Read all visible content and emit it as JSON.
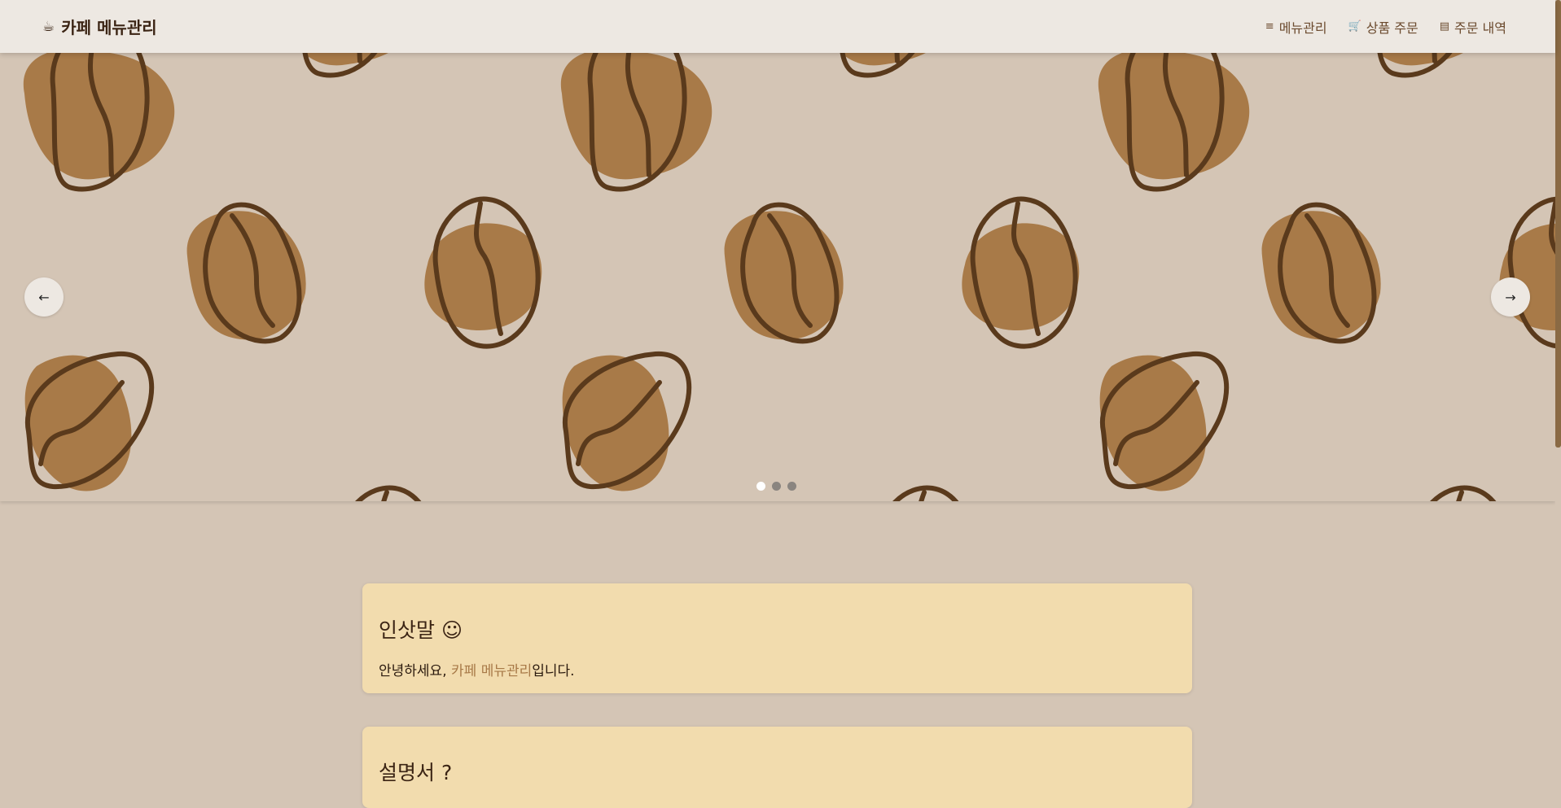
{
  "brand": {
    "icon": "coffee-cup-icon",
    "glyph": "☕",
    "title": "카페 메뉴관리"
  },
  "nav": {
    "items": [
      {
        "icon": "list-icon",
        "glyph": "≡",
        "label": "메뉴관리"
      },
      {
        "icon": "cart-icon",
        "glyph": "🛒",
        "label": "상품 주문"
      },
      {
        "icon": "receipt-icon",
        "glyph": "▤",
        "label": "주문 내역"
      }
    ]
  },
  "carousel": {
    "prev_glyph": "←",
    "next_glyph": "→",
    "slide_count": 3,
    "active_index": 0
  },
  "greeting": {
    "title": "인삿말 ☺",
    "text_before": "안녕하세요, ",
    "highlight": "카페 메뉴관리",
    "text_after": "입니다."
  },
  "manual": {
    "title": "설명서 ?"
  },
  "colors": {
    "nav_bg": "#ede8e2",
    "page_bg": "#d4c5b5",
    "card_bg": "#f2dcae",
    "bean_fill": "#a87a48",
    "bean_stroke": "#5a3a1c",
    "accent": "#a87a48"
  }
}
